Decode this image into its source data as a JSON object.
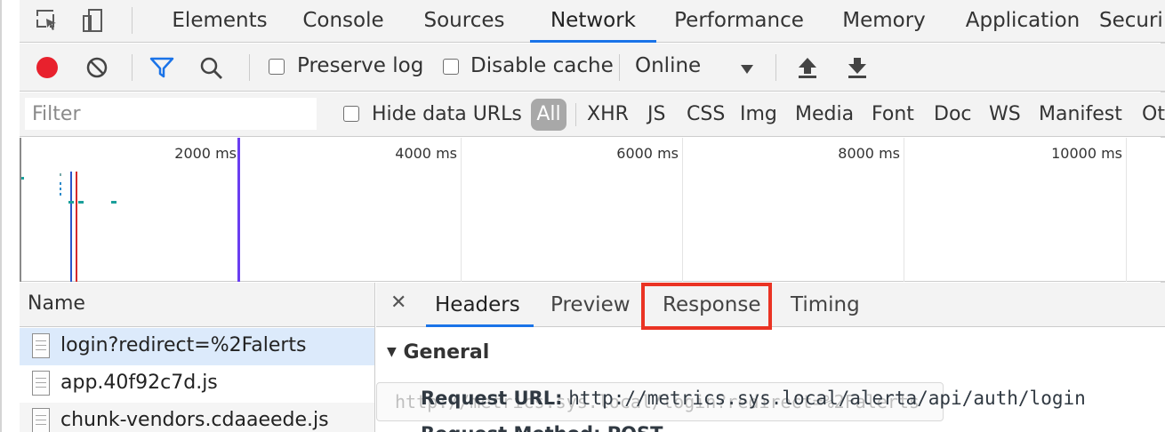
{
  "top_tabs": [
    "Elements",
    "Console",
    "Sources",
    "Network",
    "Performance",
    "Memory",
    "Application",
    "Securi"
  ],
  "active_tab": "Network",
  "toolbar": {
    "preserve_log_label": "Preserve log",
    "disable_cache_label": "Disable cache",
    "throttle_value": "Online"
  },
  "filter": {
    "placeholder": "Filter",
    "hide_data_urls_label": "Hide data URLs",
    "all_label": "All",
    "types": [
      "XHR",
      "JS",
      "CSS",
      "Img",
      "Media",
      "Font",
      "Doc",
      "WS",
      "Manifest",
      "Ot"
    ]
  },
  "overview": {
    "tick_labels": [
      "2000 ms",
      "4000 ms",
      "6000 ms",
      "8000 ms",
      "10000 ms"
    ]
  },
  "requests": {
    "header": "Name",
    "items": [
      "login?redirect=%2Falerts",
      "app.40f92c7d.js",
      "chunk-vendors.cdaaeede.js"
    ]
  },
  "detail": {
    "tabs": [
      "Headers",
      "Preview",
      "Response",
      "Timing"
    ],
    "active_tab": "Headers",
    "highlighted_tab": "Response",
    "general_title": "General",
    "request_url_key": "Request URL:",
    "request_url_value": "http://metrics.sys.local/alerta/api/auth/login",
    "request_method_row": "Request Method: POST",
    "tooltip_text": "http://metrics.sys.local/login?redirect=%2Falerts"
  },
  "colors": {
    "accent": "#1a73e8",
    "record": "#e8212d",
    "highlight": "#ea3323",
    "filter_icon": "#1a73e8"
  }
}
